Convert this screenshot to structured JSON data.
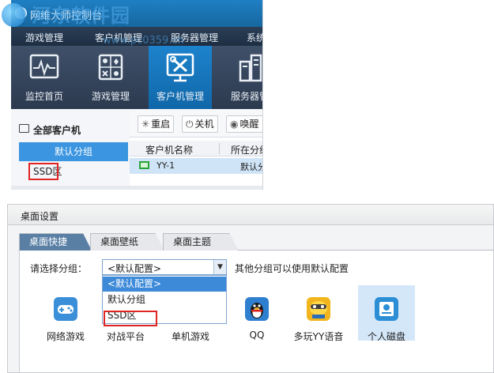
{
  "console": {
    "window_title": "网维大师控制台",
    "menu": [
      "游戏管理",
      "客户机管理",
      "服务器管理",
      "系统"
    ],
    "toolbar": [
      {
        "label": "监控首页",
        "icon": "monitor-wave-icon"
      },
      {
        "label": "游戏管理",
        "icon": "game-cards-icon"
      },
      {
        "label": "客户机管理",
        "icon": "tools-monitor-icon"
      },
      {
        "label": "服务器管",
        "icon": "server-icon"
      }
    ],
    "sidebar": {
      "header": "全部客户机",
      "items": [
        "默认分组",
        "SSD区"
      ]
    },
    "actions": [
      "重启",
      "关机",
      "唤醒"
    ],
    "table": {
      "columns": [
        "客户机名称",
        "所在分组"
      ],
      "rows": [
        [
          "YY-1",
          "默认分组"
        ]
      ]
    }
  },
  "watermark": {
    "text": "河东软件园",
    "url": "www.pc0359.cn"
  },
  "desktop_settings": {
    "title": "桌面设置",
    "tabs": [
      "桌面快捷",
      "桌面壁纸",
      "桌面主题"
    ],
    "group_label": "请选择分组：",
    "selected_group": "<默认配置>",
    "hint": "其他分组可以使用默认配置",
    "dropdown_options": [
      "<默认配置>",
      "默认分组",
      "SSD区"
    ],
    "shortcuts": [
      {
        "label": "网络游戏",
        "icon": "gamepad-icon"
      },
      {
        "label": "对战平台",
        "icon": "battle-platform-icon"
      },
      {
        "label": "单机游戏",
        "icon": "single-game-icon"
      },
      {
        "label": "QQ",
        "icon": "qq-penguin-icon"
      },
      {
        "label": "多玩YY语音",
        "icon": "yy-voice-icon"
      },
      {
        "label": "个人磁盘",
        "icon": "personal-disk-icon"
      }
    ]
  },
  "colors": {
    "accent": "#1d83cc",
    "highlight": "#3d8ad9",
    "annotation": "#e02323"
  }
}
